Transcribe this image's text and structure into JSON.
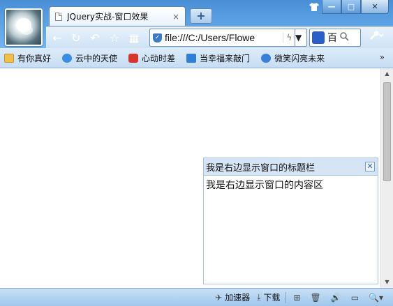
{
  "window": {
    "shirt_icon": "tshirt-icon",
    "minimize_label": "—",
    "restore_label": "□",
    "close_label": "✕"
  },
  "tab": {
    "title": "JQuery实战-窗口效果",
    "close_label": "×",
    "new_tab_label": "+"
  },
  "nav": {
    "back_glyph": "←",
    "refresh_glyph": "↻",
    "undo_glyph": "↶",
    "star_glyph": "☆",
    "apps_glyph": "▦",
    "address": "file:///C:/Users/Flowe",
    "speed_glyph": "ϟ",
    "dropdown_glyph": "▼",
    "search_engine": "百",
    "search_icon_glyph": "🔍",
    "tools_glyph": "🔧"
  },
  "bookmarks": {
    "items": [
      {
        "label": "有你真好",
        "icon": "folder-icon"
      },
      {
        "label": "云中的天使",
        "icon": "cloud-icon"
      },
      {
        "label": "心动时差",
        "icon": "heart-icon"
      },
      {
        "label": "当幸福来敲门",
        "icon": "arrow-icon"
      },
      {
        "label": "微笑闪亮未来",
        "icon": "smile-icon"
      }
    ],
    "more": "»"
  },
  "side_window": {
    "title": "我是右边显示窗口的标题栏",
    "close_label": "✕",
    "content": "我是右边显示窗口的内容区"
  },
  "status": {
    "accelerator": "加速器",
    "download": "下载"
  }
}
